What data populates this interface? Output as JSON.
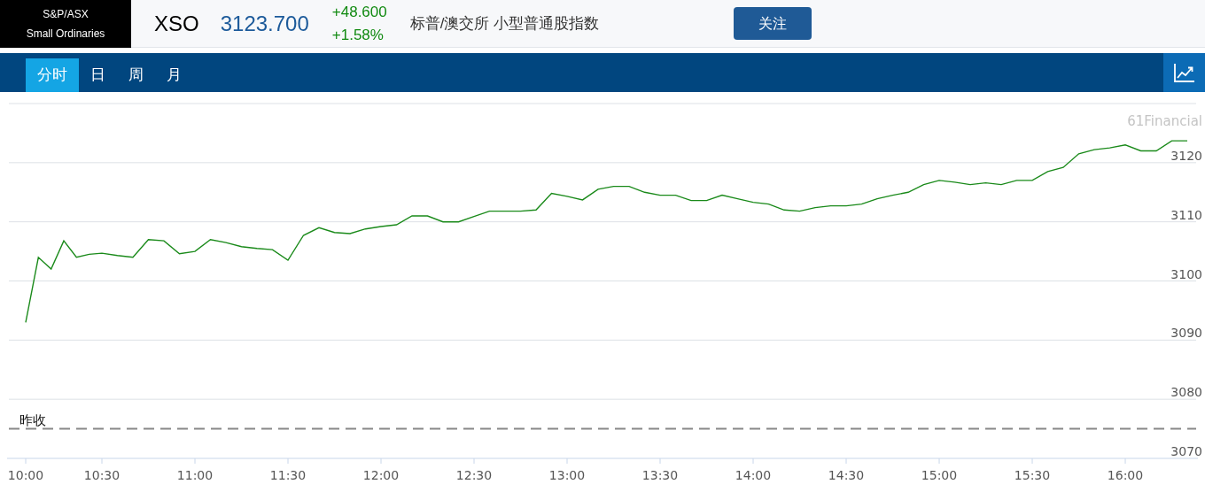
{
  "header": {
    "logo_lines": [
      "S&P/ASX",
      "Small Ordinaries"
    ],
    "symbol": "XSO",
    "price": "3123.700",
    "change": "+48.600",
    "change_percent": "+1.58%",
    "name": "标普/澳交所 小型普通股指数",
    "follow_button": "关注"
  },
  "tabs": [
    {
      "label": "分时",
      "selected": true
    },
    {
      "label": "日",
      "selected": false
    },
    {
      "label": "周",
      "selected": false
    },
    {
      "label": "月",
      "selected": false
    }
  ],
  "chart": {
    "source": "61Financial",
    "chart_data": {
      "type": "line",
      "categories": [
        "10:00",
        null,
        null,
        null,
        null,
        null,
        "10:30",
        null,
        null,
        null,
        null,
        null,
        "11:00",
        null,
        null,
        null,
        null,
        null,
        "11:30",
        null,
        null,
        null,
        null,
        null,
        "12:00",
        null,
        null,
        null,
        null,
        null,
        "12:30",
        null,
        null,
        null,
        null,
        null,
        "13:00",
        null,
        null,
        null,
        null,
        null,
        "13:30",
        null,
        null,
        null,
        null,
        null,
        "14:00",
        null,
        null,
        null,
        null,
        null,
        "14:30",
        null,
        null,
        null,
        null,
        null,
        "15:00",
        null,
        null,
        null,
        null,
        null,
        "15:30",
        null,
        null,
        null,
        null,
        null,
        "16:00",
        null,
        null,
        null,
        null
      ],
      "series": [
        {
          "color": "#1a8a1a",
          "values": [
            3093,
            3104,
            3102,
            3106.8,
            3104,
            3104.5,
            3104.7,
            3104.3,
            3104,
            3107,
            3106.8,
            3104.6,
            3105,
            3107,
            3106.5,
            3105.8,
            3105.5,
            3105.3,
            3103.5,
            3107.7,
            3109,
            3108.2,
            3108,
            3108.8,
            3109.2,
            3109.5,
            3111,
            3111,
            3110,
            3110,
            3110.9,
            3111.8,
            3111.8,
            3111.8,
            3112,
            3114.8,
            3114.3,
            3113.7,
            3115.5,
            3116,
            3116,
            3115,
            3114.5,
            3114.5,
            3113.6,
            3113.6,
            3114.5,
            3113.9,
            3113.3,
            3113,
            3112,
            3111.8,
            3112.4,
            3112.7,
            3112.7,
            3113,
            3113.9,
            3114.5,
            3115,
            3116.3,
            3117,
            3116.7,
            3116.3,
            3116.6,
            3116.3,
            3117,
            3117,
            3118.5,
            3119.2,
            3121.5,
            3122.2,
            3122.5,
            3123,
            3122,
            3122,
            3123.7,
            3123.7
          ]
        }
      ],
      "ylim": [
        3070,
        3130
      ],
      "yticks": [
        3070,
        3080,
        3090,
        3100,
        3110,
        3120
      ],
      "grid": true,
      "ref_lines": [
        {
          "axis": "y",
          "value": 3075,
          "label": "昨收"
        }
      ]
    }
  }
}
